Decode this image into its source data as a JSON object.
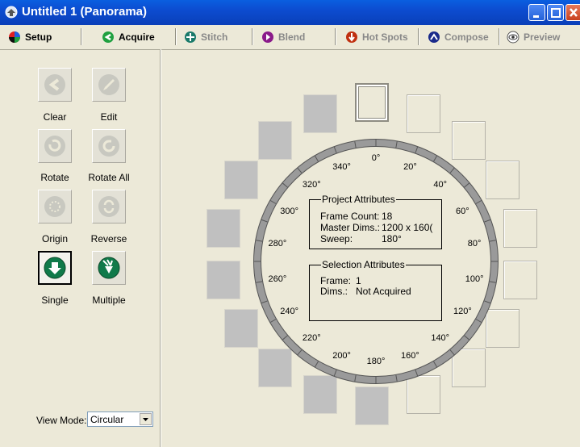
{
  "window": {
    "title": "Untitled 1 (Panorama)"
  },
  "tabs": [
    {
      "label": "Setup",
      "icon": "pie-icon"
    },
    {
      "label": "Acquire",
      "icon": "back-arrow-icon"
    },
    {
      "label": "Stitch",
      "icon": "stitch-icon"
    },
    {
      "label": "Blend",
      "icon": "blend-icon"
    },
    {
      "label": "Hot Spots",
      "icon": "hotspot-icon"
    },
    {
      "label": "Compose",
      "icon": "compose-icon"
    },
    {
      "label": "Preview",
      "icon": "eye-icon"
    }
  ],
  "tools": {
    "clear": "Clear",
    "edit": "Edit",
    "rotate": "Rotate",
    "rotate_all": "Rotate All",
    "origin": "Origin",
    "reverse": "Reverse",
    "single": "Single",
    "multiple": "Multiple"
  },
  "view_mode": {
    "label": "View Mode:",
    "value": "Circular"
  },
  "degrees": [
    "0°",
    "20°",
    "40°",
    "60°",
    "80°",
    "100°",
    "120°",
    "140°",
    "160°",
    "180°",
    "200°",
    "220°",
    "240°",
    "260°",
    "280°",
    "300°",
    "320°",
    "340°"
  ],
  "project_attributes": {
    "title": "Project Attributes",
    "frame_count_label": "Frame Count:",
    "frame_count": "18",
    "master_dims_label": "Master Dims.:",
    "master_dims": "1200 x 160(",
    "sweep_label": "Sweep:",
    "sweep": "180°"
  },
  "selection_attributes": {
    "title": "Selection Attributes",
    "frame_label": "Frame:",
    "frame": "1",
    "dims_label": "Dims.:",
    "dims": "Not Acquired"
  },
  "frames_acquired": [
    false,
    false,
    false,
    false,
    false,
    false,
    false,
    false,
    false,
    true,
    true,
    true,
    true,
    true,
    true,
    true,
    true,
    true
  ],
  "colors": {
    "accent": "#0a5fe0",
    "acquired_frame": "#c0c0c0",
    "tool_icon": "#c8c8c0",
    "active_icon": "#107a4a"
  }
}
